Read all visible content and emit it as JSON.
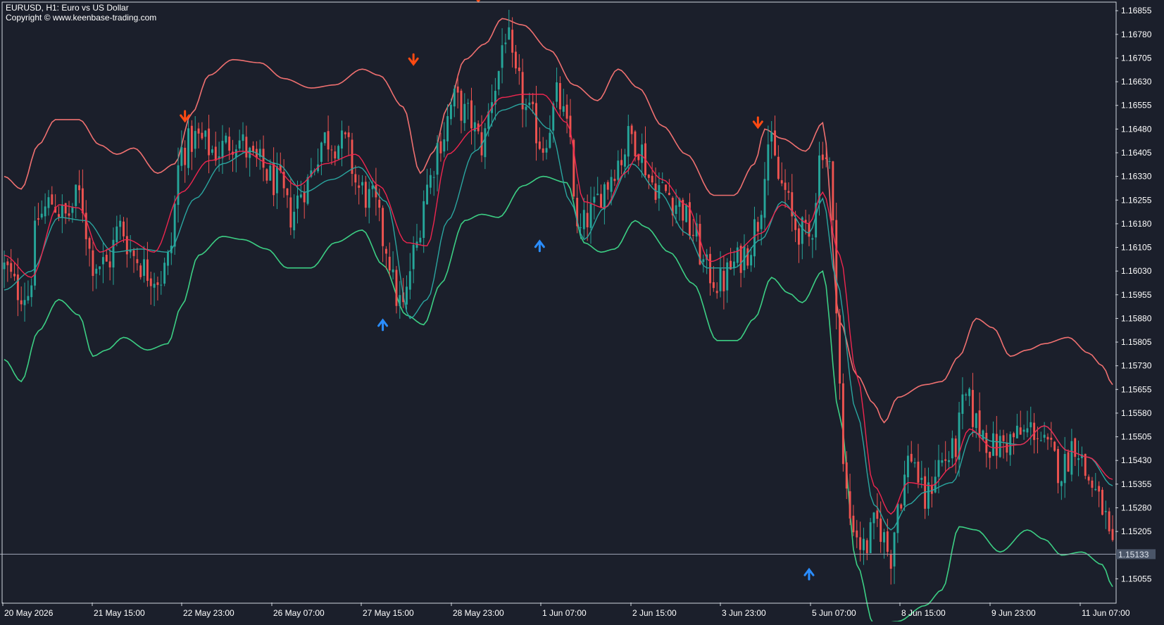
{
  "header": {
    "title": "EURUSD, H1:  Euro vs US Dollar",
    "copyright": "Copyright © www.keenbase-trading.com"
  },
  "colors": {
    "background": "#1b1f2b",
    "bull": "#26a69a",
    "bear": "#ef5350",
    "upper_band": "#f07070",
    "lower_band": "#3ccf84",
    "mid_fast": "#f0264f",
    "mid_slow": "#2aa6a0",
    "sell_arrow": "#ff4a12",
    "buy_arrow": "#2a8dff",
    "price_line": "#a0a8b8",
    "axis_text": "#ffffff"
  },
  "chart_data": {
    "type": "candlestick",
    "symbol": "EURUSD",
    "timeframe": "H1",
    "ylim": [
      1.1498,
      1.1688
    ],
    "y_ticks": [
      "1.16855",
      "1.16780",
      "1.16705",
      "1.16630",
      "1.16555",
      "1.16480",
      "1.16405",
      "1.16330",
      "1.16255",
      "1.16180",
      "1.16105",
      "1.16030",
      "1.15955",
      "1.15880",
      "1.15805",
      "1.15730",
      "1.15655",
      "1.15580",
      "1.15505",
      "1.15430",
      "1.15355",
      "1.15280",
      "1.15205",
      "1.15055"
    ],
    "x_ticks": [
      "20 May 2026",
      "21 May 15:00",
      "22 May 23:00",
      "26 May 07:00",
      "27 May 15:00",
      "28 May 23:00",
      "1 Jun 07:00",
      "2 Jun 15:00",
      "3 Jun 23:00",
      "5 Jun 07:00",
      "8 Jun 15:00",
      "9 Jun 23:00",
      "11 Jun 07:00"
    ],
    "current_price": "1.15133",
    "upper_band": [
      [
        0,
        1.1633
      ],
      [
        5,
        1.1629
      ],
      [
        10,
        1.1643
      ],
      [
        15,
        1.1651
      ],
      [
        22,
        1.1651
      ],
      [
        28,
        1.1643
      ],
      [
        33,
        1.164
      ],
      [
        38,
        1.1642
      ],
      [
        45,
        1.1634
      ],
      [
        50,
        1.1637
      ],
      [
        55,
        1.1653
      ],
      [
        60,
        1.1665
      ],
      [
        67,
        1.167
      ],
      [
        75,
        1.1669
      ],
      [
        82,
        1.1664
      ],
      [
        90,
        1.1661
      ],
      [
        97,
        1.1662
      ],
      [
        105,
        1.1667
      ],
      [
        110,
        1.1665
      ],
      [
        117,
        1.1655
      ],
      [
        122,
        1.1634
      ],
      [
        126,
        1.1641
      ],
      [
        130,
        1.1655
      ],
      [
        135,
        1.167
      ],
      [
        141,
        1.1675
      ],
      [
        146,
        1.1683
      ],
      [
        152,
        1.1681
      ],
      [
        160,
        1.1673
      ],
      [
        167,
        1.1662
      ],
      [
        174,
        1.1657
      ],
      [
        180,
        1.1667
      ],
      [
        186,
        1.1661
      ],
      [
        193,
        1.1649
      ],
      [
        200,
        1.164
      ],
      [
        208,
        1.1627
      ],
      [
        214,
        1.1627
      ],
      [
        220,
        1.1637
      ],
      [
        223,
        1.1648
      ],
      [
        228,
        1.1645
      ],
      [
        235,
        1.1641
      ],
      [
        240,
        1.165
      ],
      [
        245,
        1.1587
      ],
      [
        250,
        1.157
      ],
      [
        255,
        1.1561
      ],
      [
        258,
        1.1555
      ],
      [
        262,
        1.1563
      ],
      [
        270,
        1.1567
      ],
      [
        275,
        1.1568
      ],
      [
        280,
        1.1576
      ],
      [
        285,
        1.1588
      ],
      [
        290,
        1.1585
      ],
      [
        295,
        1.1576
      ],
      [
        300,
        1.1578
      ],
      [
        305,
        1.158
      ],
      [
        312,
        1.1582
      ],
      [
        318,
        1.1577
      ],
      [
        322,
        1.1573
      ],
      [
        325,
        1.1567
      ]
    ],
    "lower_band": [
      [
        0,
        1.1575
      ],
      [
        5,
        1.1568
      ],
      [
        10,
        1.1584
      ],
      [
        16,
        1.1594
      ],
      [
        22,
        1.1589
      ],
      [
        26,
        1.1576
      ],
      [
        30,
        1.1578
      ],
      [
        35,
        1.1582
      ],
      [
        42,
        1.1578
      ],
      [
        48,
        1.158
      ],
      [
        52,
        1.1592
      ],
      [
        57,
        1.1608
      ],
      [
        64,
        1.1614
      ],
      [
        70,
        1.1613
      ],
      [
        77,
        1.161
      ],
      [
        83,
        1.1604
      ],
      [
        90,
        1.1604
      ],
      [
        97,
        1.1612
      ],
      [
        105,
        1.1616
      ],
      [
        111,
        1.1605
      ],
      [
        118,
        1.1589
      ],
      [
        123,
        1.1586
      ],
      [
        128,
        1.1599
      ],
      [
        135,
        1.1619
      ],
      [
        140,
        1.1621
      ],
      [
        145,
        1.162
      ],
      [
        152,
        1.163
      ],
      [
        158,
        1.1633
      ],
      [
        165,
        1.1631
      ],
      [
        170,
        1.1612
      ],
      [
        175,
        1.1609
      ],
      [
        179,
        1.161
      ],
      [
        185,
        1.1619
      ],
      [
        188,
        1.1617
      ],
      [
        195,
        1.1609
      ],
      [
        202,
        1.1599
      ],
      [
        209,
        1.1581
      ],
      [
        215,
        1.1581
      ],
      [
        220,
        1.1588
      ],
      [
        225,
        1.1601
      ],
      [
        230,
        1.1596
      ],
      [
        234,
        1.1593
      ],
      [
        240,
        1.1603
      ],
      [
        245,
        1.1557
      ],
      [
        250,
        1.151
      ],
      [
        255,
        1.1491
      ],
      [
        262,
        1.1492
      ],
      [
        270,
        1.1497
      ],
      [
        275,
        1.1502
      ],
      [
        280,
        1.1522
      ],
      [
        285,
        1.1521
      ],
      [
        292,
        1.1514
      ],
      [
        300,
        1.1521
      ],
      [
        305,
        1.1518
      ],
      [
        310,
        1.1513
      ],
      [
        316,
        1.1514
      ],
      [
        322,
        1.151
      ],
      [
        325,
        1.1503
      ]
    ],
    "mid_fast": [
      [
        0,
        1.1608
      ],
      [
        8,
        1.1601
      ],
      [
        16,
        1.1624
      ],
      [
        22,
        1.1623
      ],
      [
        28,
        1.1609
      ],
      [
        36,
        1.1613
      ],
      [
        44,
        1.1609
      ],
      [
        52,
        1.1628
      ],
      [
        60,
        1.1638
      ],
      [
        70,
        1.1641
      ],
      [
        78,
        1.1637
      ],
      [
        86,
        1.163
      ],
      [
        94,
        1.1637
      ],
      [
        103,
        1.164
      ],
      [
        110,
        1.163
      ],
      [
        118,
        1.1612
      ],
      [
        124,
        1.1611
      ],
      [
        130,
        1.164
      ],
      [
        138,
        1.1648
      ],
      [
        146,
        1.1658
      ],
      [
        152,
        1.1659
      ],
      [
        158,
        1.1659
      ],
      [
        165,
        1.165
      ],
      [
        170,
        1.1625
      ],
      [
        176,
        1.1623
      ],
      [
        182,
        1.1634
      ],
      [
        186,
        1.164
      ],
      [
        193,
        1.1632
      ],
      [
        200,
        1.1624
      ],
      [
        207,
        1.1606
      ],
      [
        214,
        1.1609
      ],
      [
        222,
        1.1615
      ],
      [
        228,
        1.1624
      ],
      [
        236,
        1.1618
      ],
      [
        240,
        1.1628
      ],
      [
        245,
        1.1608
      ],
      [
        250,
        1.157
      ],
      [
        255,
        1.1535
      ],
      [
        260,
        1.1526
      ],
      [
        265,
        1.1536
      ],
      [
        272,
        1.1535
      ],
      [
        278,
        1.1541
      ],
      [
        283,
        1.1553
      ],
      [
        290,
        1.1547
      ],
      [
        298,
        1.1548
      ],
      [
        305,
        1.1554
      ],
      [
        312,
        1.1546
      ],
      [
        318,
        1.1544
      ],
      [
        325,
        1.1537
      ]
    ],
    "mid_slow": [
      [
        0,
        1.1597
      ],
      [
        8,
        1.1603
      ],
      [
        16,
        1.162
      ],
      [
        24,
        1.1619
      ],
      [
        32,
        1.1609
      ],
      [
        40,
        1.161
      ],
      [
        48,
        1.1609
      ],
      [
        56,
        1.1626
      ],
      [
        64,
        1.1637
      ],
      [
        72,
        1.1641
      ],
      [
        80,
        1.1637
      ],
      [
        88,
        1.1628
      ],
      [
        96,
        1.1632
      ],
      [
        104,
        1.1636
      ],
      [
        112,
        1.1625
      ],
      [
        119,
        1.1588
      ],
      [
        124,
        1.1594
      ],
      [
        130,
        1.1619
      ],
      [
        138,
        1.1641
      ],
      [
        146,
        1.1654
      ],
      [
        152,
        1.1656
      ],
      [
        160,
        1.1648
      ],
      [
        166,
        1.1625
      ],
      [
        170,
        1.1613
      ],
      [
        176,
        1.1623
      ],
      [
        184,
        1.1637
      ],
      [
        192,
        1.1628
      ],
      [
        200,
        1.1615
      ],
      [
        206,
        1.1604
      ],
      [
        214,
        1.1604
      ],
      [
        222,
        1.1613
      ],
      [
        228,
        1.1625
      ],
      [
        236,
        1.1615
      ],
      [
        240,
        1.1626
      ],
      [
        244,
        1.16
      ],
      [
        250,
        1.1558
      ],
      [
        255,
        1.1529
      ],
      [
        260,
        1.1521
      ],
      [
        265,
        1.1529
      ],
      [
        270,
        1.1533
      ],
      [
        278,
        1.1536
      ],
      [
        284,
        1.1552
      ],
      [
        290,
        1.1549
      ],
      [
        298,
        1.1548
      ],
      [
        305,
        1.1554
      ],
      [
        312,
        1.1546
      ],
      [
        318,
        1.1544
      ],
      [
        325,
        1.1535
      ]
    ],
    "price_anchors": [
      [
        0,
        1.1604
      ],
      [
        4,
        1.1597
      ],
      [
        7,
        1.1596
      ],
      [
        10,
        1.162
      ],
      [
        14,
        1.1625
      ],
      [
        18,
        1.162
      ],
      [
        22,
        1.1627
      ],
      [
        26,
        1.1606
      ],
      [
        30,
        1.1605
      ],
      [
        34,
        1.1617
      ],
      [
        38,
        1.1608
      ],
      [
        42,
        1.1603
      ],
      [
        46,
        1.1601
      ],
      [
        48,
        1.1606
      ],
      [
        52,
        1.1641
      ],
      [
        56,
        1.1645
      ],
      [
        62,
        1.1641
      ],
      [
        68,
        1.1645
      ],
      [
        74,
        1.1637
      ],
      [
        80,
        1.1631
      ],
      [
        84,
        1.1621
      ],
      [
        88,
        1.163
      ],
      [
        94,
        1.1645
      ],
      [
        100,
        1.1643
      ],
      [
        104,
        1.1629
      ],
      [
        108,
        1.1625
      ],
      [
        112,
        1.1611
      ],
      [
        115,
        1.1595
      ],
      [
        117,
        1.1591
      ],
      [
        120,
        1.1608
      ],
      [
        124,
        1.163
      ],
      [
        128,
        1.1645
      ],
      [
        132,
        1.1657
      ],
      [
        136,
        1.1652
      ],
      [
        140,
        1.1643
      ],
      [
        144,
        1.1662
      ],
      [
        147,
        1.1679
      ],
      [
        150,
        1.1663
      ],
      [
        154,
        1.1652
      ],
      [
        158,
        1.1643
      ],
      [
        160,
        1.165
      ],
      [
        162,
        1.1658
      ],
      [
        166,
        1.1645
      ],
      [
        168,
        1.1614
      ],
      [
        172,
        1.1621
      ],
      [
        176,
        1.163
      ],
      [
        180,
        1.1638
      ],
      [
        184,
        1.1646
      ],
      [
        186,
        1.1643
      ],
      [
        190,
        1.1631
      ],
      [
        194,
        1.1628
      ],
      [
        198,
        1.1624
      ],
      [
        202,
        1.1615
      ],
      [
        206,
        1.1603
      ],
      [
        210,
        1.1599
      ],
      [
        214,
        1.1605
      ],
      [
        218,
        1.161
      ],
      [
        221,
        1.1619
      ],
      [
        224,
        1.1644
      ],
      [
        228,
        1.163
      ],
      [
        232,
        1.1617
      ],
      [
        236,
        1.1613
      ],
      [
        240,
        1.1643
      ],
      [
        242,
        1.1636
      ],
      [
        244,
        1.1595
      ],
      [
        246,
        1.154
      ],
      [
        248,
        1.1525
      ],
      [
        252,
        1.1515
      ],
      [
        256,
        1.1523
      ],
      [
        260,
        1.1513
      ],
      [
        262,
        1.153
      ],
      [
        266,
        1.1545
      ],
      [
        270,
        1.153
      ],
      [
        274,
        1.1542
      ],
      [
        278,
        1.1545
      ],
      [
        282,
        1.1562
      ],
      [
        286,
        1.1553
      ],
      [
        290,
        1.1547
      ],
      [
        294,
        1.1549
      ],
      [
        298,
        1.1551
      ],
      [
        302,
        1.1553
      ],
      [
        306,
        1.1546
      ],
      [
        310,
        1.154
      ],
      [
        314,
        1.1549
      ],
      [
        318,
        1.1537
      ],
      [
        322,
        1.1528
      ],
      [
        325,
        1.1513
      ]
    ],
    "sell_signals": [
      [
        53,
        1.1651
      ],
      [
        120,
        1.1669
      ],
      [
        139,
        1.1689
      ],
      [
        221,
        1.1649
      ]
    ],
    "buy_signals": [
      [
        111,
        1.1587
      ],
      [
        157,
        1.1612
      ],
      [
        236,
        1.1508
      ]
    ]
  }
}
